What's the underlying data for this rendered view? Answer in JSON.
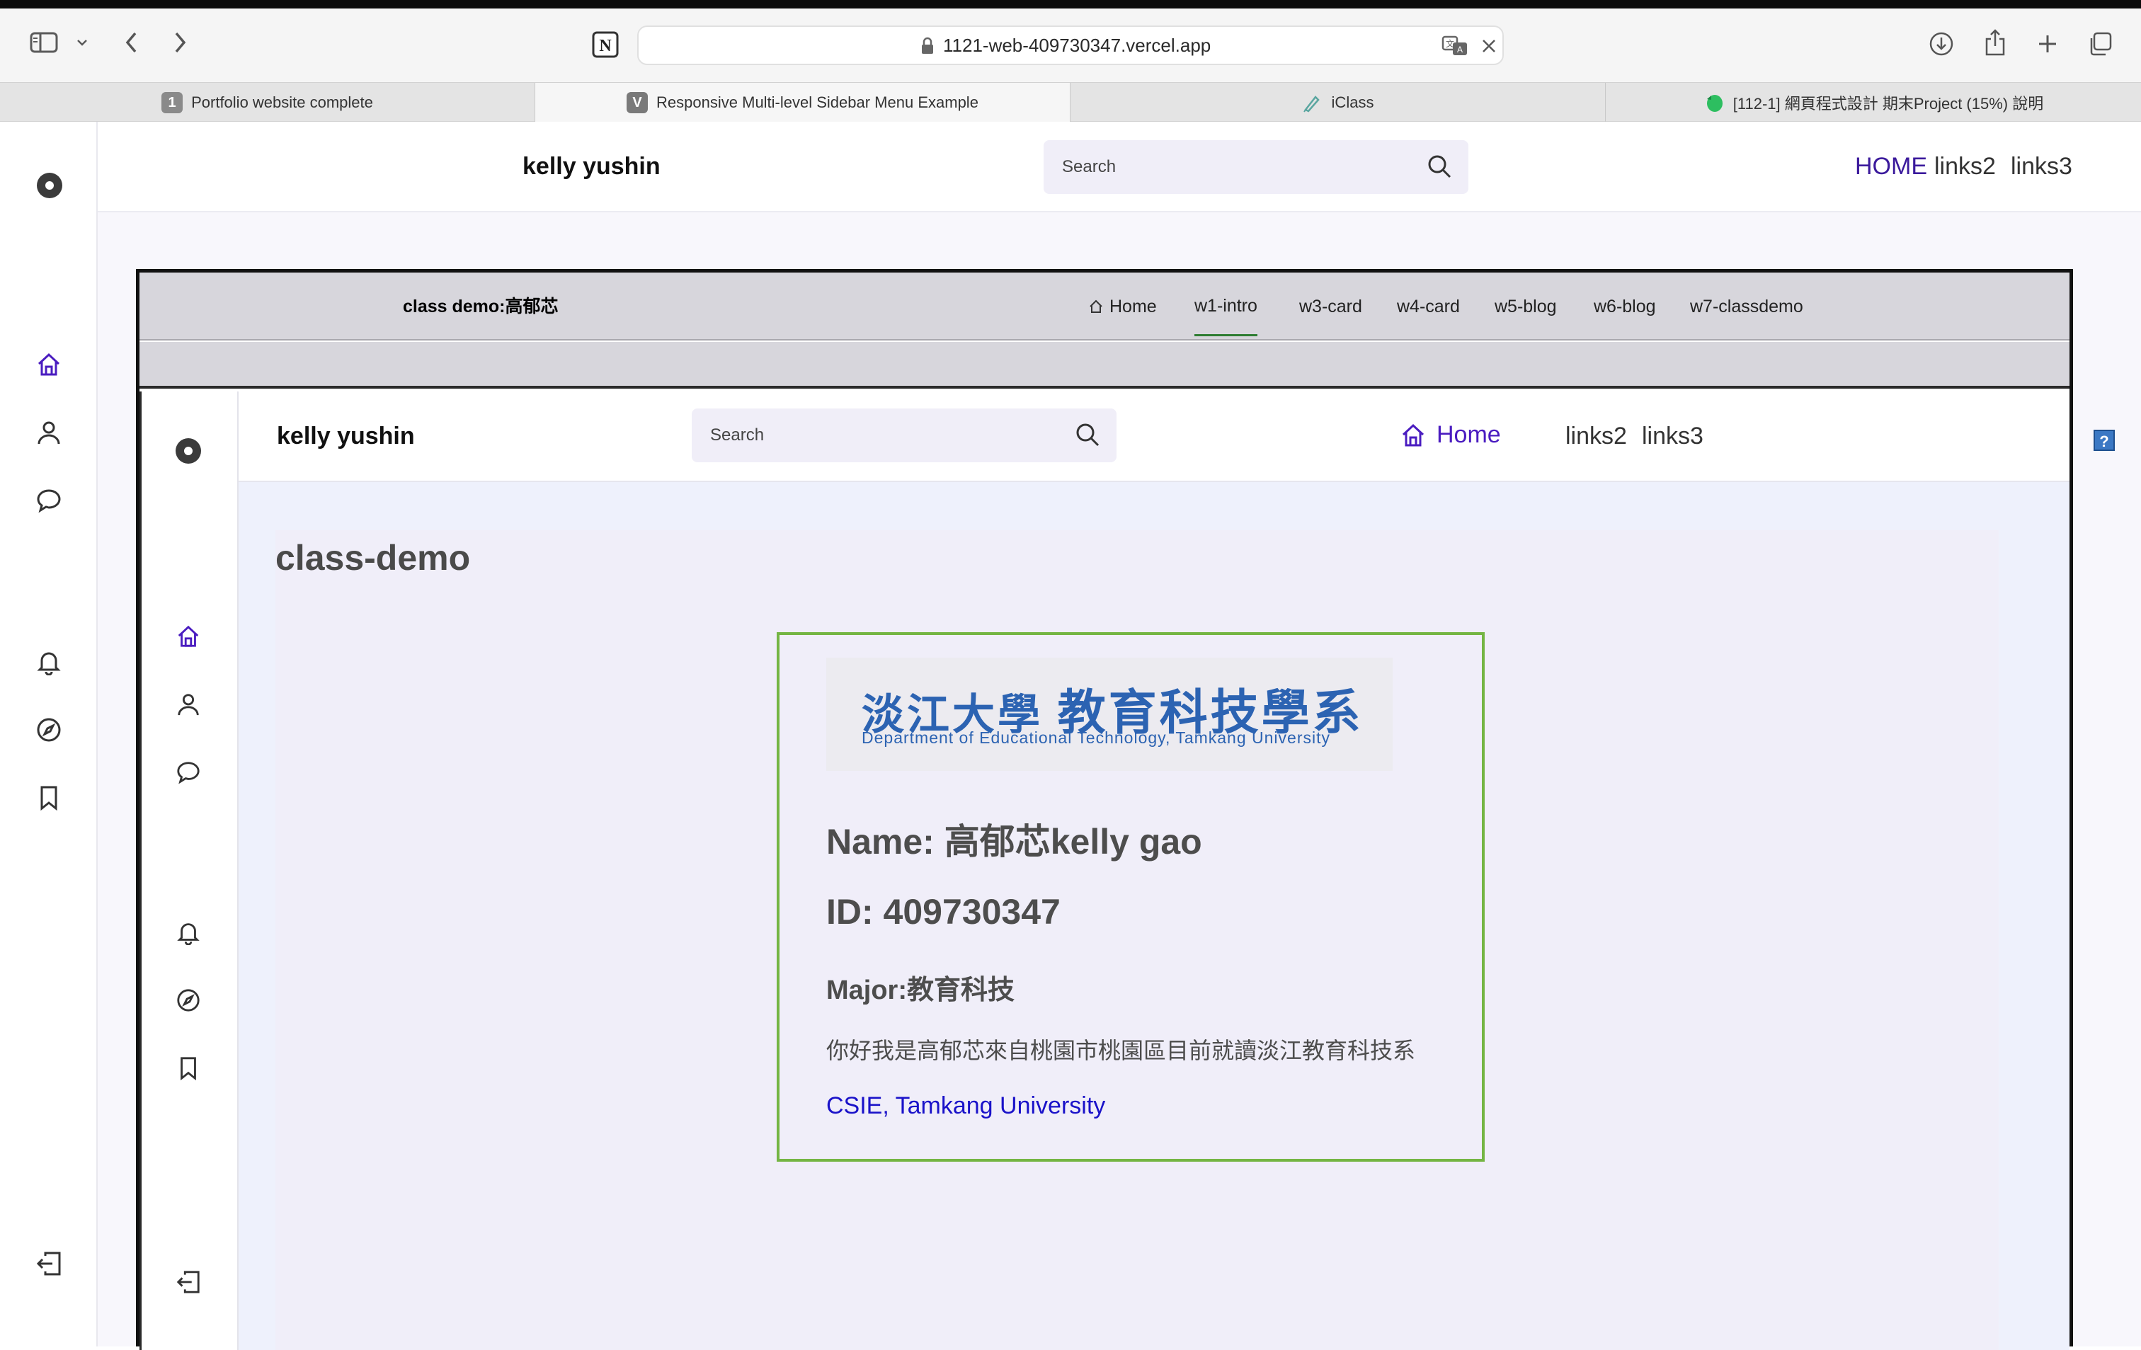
{
  "browser": {
    "url": "1121-web-409730347.vercel.app",
    "tabs": [
      {
        "label": "Portfolio website complete",
        "favicon": "1"
      },
      {
        "label": "Responsive Multi-level Sidebar Menu Example",
        "favicon": "V"
      },
      {
        "label": "iClass",
        "favicon": ""
      },
      {
        "label": "[112-1] 網頁程式設計 期末Project (15%) 說明",
        "favicon": ""
      }
    ]
  },
  "outer": {
    "brand": "kelly yushin",
    "search_placeholder": "Search",
    "nav": [
      "HOME",
      "links2",
      "links3"
    ]
  },
  "frame_nav": {
    "title": "class demo:高郁芯",
    "links": [
      "Home",
      "w1-intro",
      "w3-card",
      "w4-card",
      "w5-blog",
      "w6-blog",
      "w7-classdemo"
    ]
  },
  "inner": {
    "brand": "kelly yushin",
    "search_placeholder": "Search",
    "nav": [
      "Home",
      "links2",
      "links3"
    ],
    "help_label": "?"
  },
  "content": {
    "heading": "class-demo",
    "logo_cn_school": "淡江大學",
    "logo_cn_dept": "教育科技學系",
    "logo_en": "Department of Educational Technology, Tamkang University",
    "name": "Name: 高郁芯kelly gao",
    "id": "ID: 409730347",
    "major": "Major:教育科技",
    "intro": "你好我是高郁芯來自桃園市桃園區目前就讀淡江教育科技系",
    "link": "CSIE, Tamkang University"
  },
  "colors": {
    "accent": "#3b1a9c",
    "card_border": "#74b543",
    "link": "#1a12c9",
    "logo_blue": "#2c63b2"
  }
}
